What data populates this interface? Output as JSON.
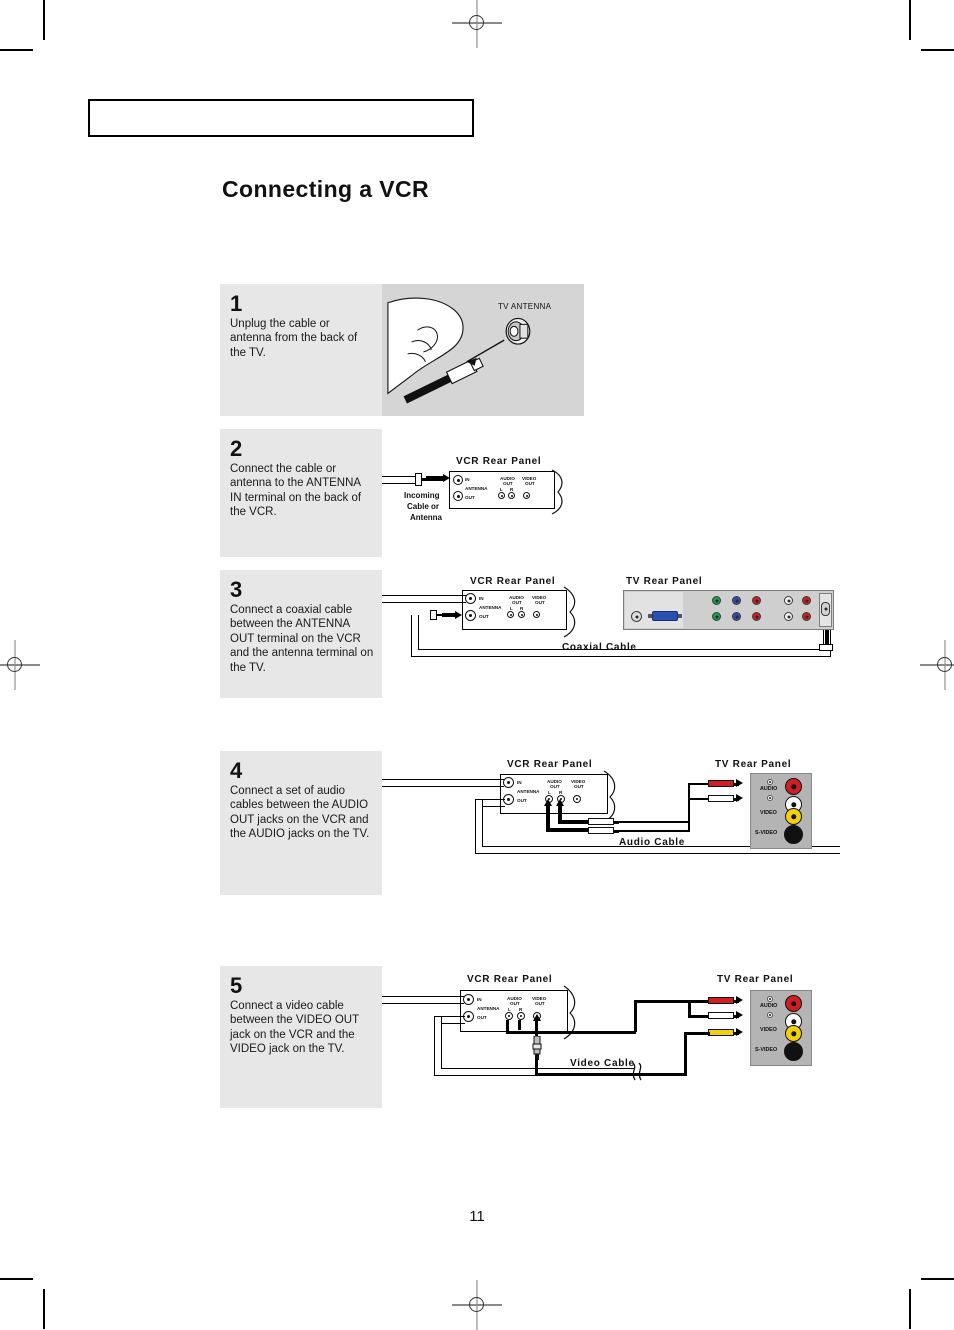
{
  "document": {
    "page_title": "Connecting a VCR",
    "page_number": "11"
  },
  "steps": [
    {
      "number": "1",
      "text": "Unplug the cable or antenna from the back of the TV.",
      "figure": {
        "kind": "photo-illustration",
        "labels": [
          "TV ANTENNA"
        ]
      }
    },
    {
      "number": "2",
      "text": "Connect the cable or antenna to the ANTENNA IN terminal on the back of the VCR.",
      "figure": {
        "kind": "diagram",
        "vcr_panel_title": "VCR  Rear  Panel",
        "source_label": "Incoming\nCable  or\nAntenna",
        "source_label_lines": [
          "Incoming",
          "Cable  or",
          "Antenna"
        ],
        "vcr_jack_labels": [
          "IN",
          "ANTENNA",
          "OUT",
          "AUDIO",
          "OUT",
          "L",
          "R",
          "VIDEO",
          "OUT"
        ]
      }
    },
    {
      "number": "3",
      "text": "Connect a coaxial cable between the ANTENNA OUT terminal on the VCR and the antenna terminal on the TV.",
      "figure": {
        "kind": "diagram",
        "vcr_panel_title": "VCR  Rear  Panel",
        "tv_panel_title": "TV  Rear  Panel",
        "cable_label": "Coaxial  Cable",
        "vcr_jack_labels": [
          "IN",
          "ANTENNA",
          "OUT",
          "AUDIO",
          "OUT",
          "L",
          "R",
          "VIDEO",
          "OUT"
        ],
        "tv_jack_colors": [
          "#18a04a",
          "#2b50b0",
          "#cf1f22",
          "#18a04a",
          "#2b50b0",
          "#cf1f22",
          "#f4f4f4",
          "#cf1f22",
          "#f4f4f4",
          "#cf1f22"
        ]
      }
    },
    {
      "number": "4",
      "text": "Connect a set of audio cables between the AUDIO OUT jacks on the VCR and the AUDIO jacks on the TV.",
      "figure": {
        "kind": "diagram",
        "vcr_panel_title": "VCR  Rear  Panel",
        "tv_panel_title": "TV  Rear  Panel",
        "cable_label": "Audio Cable",
        "vcr_jack_labels": [
          "IN",
          "ANTENNA",
          "OUT",
          "AUDIO",
          "OUT",
          "L",
          "R",
          "VIDEO",
          "OUT"
        ],
        "tv_side_labels": [
          "AUDIO",
          "VIDEO",
          "S-VIDEO"
        ],
        "tv_side_jacks": [
          {
            "name": "audio-right",
            "color": "#cf1f22"
          },
          {
            "name": "audio-left",
            "color": "#ffffff"
          },
          {
            "name": "video",
            "color": "#f2d00a"
          },
          {
            "name": "s-video",
            "color": "#111111"
          }
        ],
        "plug_colors": [
          "#cf1f22",
          "#ffffff"
        ]
      }
    },
    {
      "number": "5",
      "text": "Connect a video cable between the VIDEO OUT jack on the VCR and the VIDEO jack on the TV.",
      "figure": {
        "kind": "diagram",
        "vcr_panel_title": "VCR  Rear  Panel",
        "tv_panel_title": "TV  Rear  Panel",
        "cable_label": "Video  Cable",
        "vcr_jack_labels": [
          "IN",
          "ANTENNA",
          "OUT",
          "AUDIO",
          "OUT",
          "L",
          "R",
          "VIDEO",
          "OUT"
        ],
        "tv_side_labels": [
          "AUDIO",
          "VIDEO",
          "S-VIDEO"
        ],
        "tv_side_jacks": [
          {
            "name": "audio-right",
            "color": "#cf1f22"
          },
          {
            "name": "audio-left",
            "color": "#ffffff"
          },
          {
            "name": "video",
            "color": "#f2d00a"
          },
          {
            "name": "s-video",
            "color": "#111111"
          }
        ],
        "plug_colors": [
          "#cf1f22",
          "#ffffff",
          "#f2d00a"
        ]
      }
    }
  ],
  "jack_text": {
    "in": "IN",
    "antenna": "ANTENNA",
    "out": "OUT",
    "audio": "AUDIO",
    "audio_out": "AUDIO\nOUT",
    "video_out": "VIDEO\nOUT",
    "l": "L",
    "r": "R",
    "video": "VIDEO",
    "svideo": "S-VIDEO"
  }
}
